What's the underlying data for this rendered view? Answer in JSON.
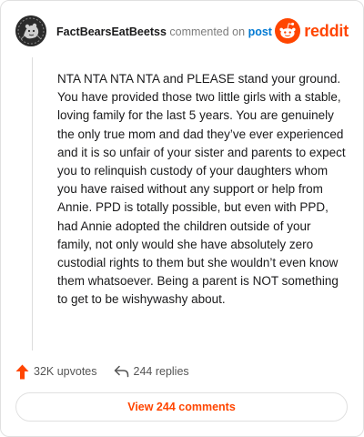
{
  "header": {
    "username": "FactBearsEatBeetss",
    "action_text": "commented on",
    "post_link": "post",
    "brand": "reddit",
    "avatar_icon": "avatar-bear-icon",
    "brand_icon": "reddit-snoo-icon"
  },
  "comment": {
    "body": "NTA NTA NTA NTA and PLEASE stand your ground. You have provided those two little girls with a stable, loving family for the last 5 years. You are genuinely the only true mom and dad they’ve ever experienced and it is so unfair of your sister and parents to expect you to relinquish custody of your daughters whom you have raised without any support or help from Annie. PPD is totally possible, but even with PPD, had Annie adopted the children outside of your family, not only would she have absolutely zero custodial rights to them but she wouldn’t even know them whatsoever. Being a parent is NOT something to get to be wishywashy about."
  },
  "actions": {
    "upvotes_label": "32K upvotes",
    "replies_label": "244 replies",
    "upvote_icon": "upvote-arrow-icon",
    "reply_icon": "reply-arrow-icon"
  },
  "footer": {
    "view_comments_label": "View 244 comments"
  },
  "colors": {
    "brand": "#ff4500",
    "link": "#0079d3",
    "text": "#1a1a1b",
    "muted": "#7c7c7c",
    "border": "#e0e0e0"
  }
}
